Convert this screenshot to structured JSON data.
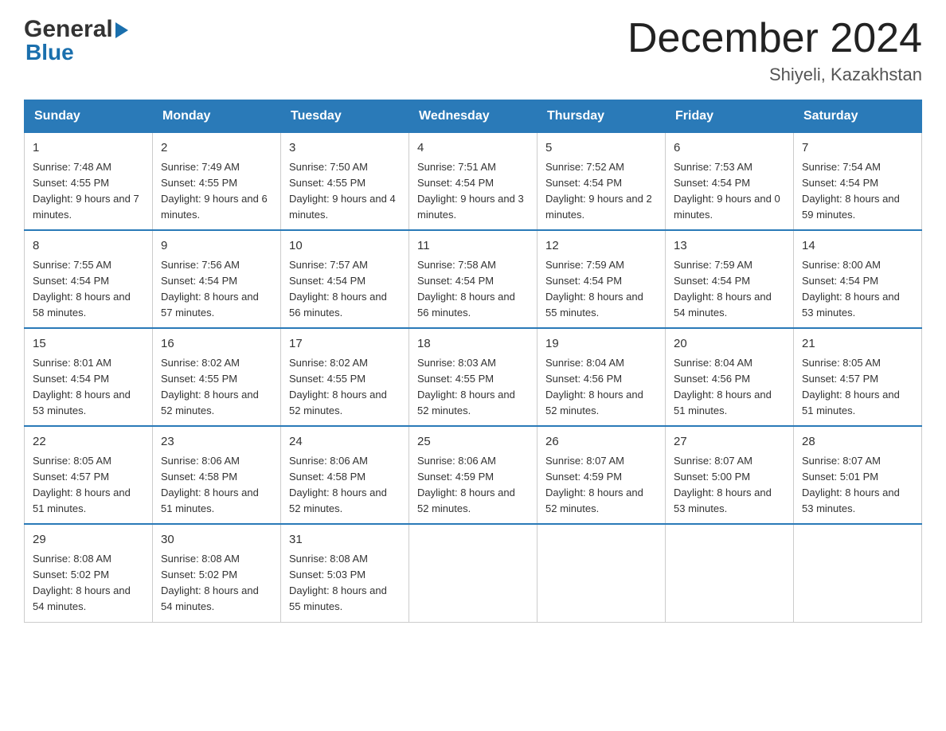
{
  "header": {
    "logo": {
      "general": "General",
      "blue": "Blue"
    },
    "title": "December 2024",
    "location": "Shiyeli, Kazakhstan"
  },
  "weekdays": [
    "Sunday",
    "Monday",
    "Tuesday",
    "Wednesday",
    "Thursday",
    "Friday",
    "Saturday"
  ],
  "weeks": [
    [
      {
        "day": "1",
        "sunrise": "7:48 AM",
        "sunset": "4:55 PM",
        "daylight": "9 hours and 7 minutes."
      },
      {
        "day": "2",
        "sunrise": "7:49 AM",
        "sunset": "4:55 PM",
        "daylight": "9 hours and 6 minutes."
      },
      {
        "day": "3",
        "sunrise": "7:50 AM",
        "sunset": "4:55 PM",
        "daylight": "9 hours and 4 minutes."
      },
      {
        "day": "4",
        "sunrise": "7:51 AM",
        "sunset": "4:54 PM",
        "daylight": "9 hours and 3 minutes."
      },
      {
        "day": "5",
        "sunrise": "7:52 AM",
        "sunset": "4:54 PM",
        "daylight": "9 hours and 2 minutes."
      },
      {
        "day": "6",
        "sunrise": "7:53 AM",
        "sunset": "4:54 PM",
        "daylight": "9 hours and 0 minutes."
      },
      {
        "day": "7",
        "sunrise": "7:54 AM",
        "sunset": "4:54 PM",
        "daylight": "8 hours and 59 minutes."
      }
    ],
    [
      {
        "day": "8",
        "sunrise": "7:55 AM",
        "sunset": "4:54 PM",
        "daylight": "8 hours and 58 minutes."
      },
      {
        "day": "9",
        "sunrise": "7:56 AM",
        "sunset": "4:54 PM",
        "daylight": "8 hours and 57 minutes."
      },
      {
        "day": "10",
        "sunrise": "7:57 AM",
        "sunset": "4:54 PM",
        "daylight": "8 hours and 56 minutes."
      },
      {
        "day": "11",
        "sunrise": "7:58 AM",
        "sunset": "4:54 PM",
        "daylight": "8 hours and 56 minutes."
      },
      {
        "day": "12",
        "sunrise": "7:59 AM",
        "sunset": "4:54 PM",
        "daylight": "8 hours and 55 minutes."
      },
      {
        "day": "13",
        "sunrise": "7:59 AM",
        "sunset": "4:54 PM",
        "daylight": "8 hours and 54 minutes."
      },
      {
        "day": "14",
        "sunrise": "8:00 AM",
        "sunset": "4:54 PM",
        "daylight": "8 hours and 53 minutes."
      }
    ],
    [
      {
        "day": "15",
        "sunrise": "8:01 AM",
        "sunset": "4:54 PM",
        "daylight": "8 hours and 53 minutes."
      },
      {
        "day": "16",
        "sunrise": "8:02 AM",
        "sunset": "4:55 PM",
        "daylight": "8 hours and 52 minutes."
      },
      {
        "day": "17",
        "sunrise": "8:02 AM",
        "sunset": "4:55 PM",
        "daylight": "8 hours and 52 minutes."
      },
      {
        "day": "18",
        "sunrise": "8:03 AM",
        "sunset": "4:55 PM",
        "daylight": "8 hours and 52 minutes."
      },
      {
        "day": "19",
        "sunrise": "8:04 AM",
        "sunset": "4:56 PM",
        "daylight": "8 hours and 52 minutes."
      },
      {
        "day": "20",
        "sunrise": "8:04 AM",
        "sunset": "4:56 PM",
        "daylight": "8 hours and 51 minutes."
      },
      {
        "day": "21",
        "sunrise": "8:05 AM",
        "sunset": "4:57 PM",
        "daylight": "8 hours and 51 minutes."
      }
    ],
    [
      {
        "day": "22",
        "sunrise": "8:05 AM",
        "sunset": "4:57 PM",
        "daylight": "8 hours and 51 minutes."
      },
      {
        "day": "23",
        "sunrise": "8:06 AM",
        "sunset": "4:58 PM",
        "daylight": "8 hours and 51 minutes."
      },
      {
        "day": "24",
        "sunrise": "8:06 AM",
        "sunset": "4:58 PM",
        "daylight": "8 hours and 52 minutes."
      },
      {
        "day": "25",
        "sunrise": "8:06 AM",
        "sunset": "4:59 PM",
        "daylight": "8 hours and 52 minutes."
      },
      {
        "day": "26",
        "sunrise": "8:07 AM",
        "sunset": "4:59 PM",
        "daylight": "8 hours and 52 minutes."
      },
      {
        "day": "27",
        "sunrise": "8:07 AM",
        "sunset": "5:00 PM",
        "daylight": "8 hours and 53 minutes."
      },
      {
        "day": "28",
        "sunrise": "8:07 AM",
        "sunset": "5:01 PM",
        "daylight": "8 hours and 53 minutes."
      }
    ],
    [
      {
        "day": "29",
        "sunrise": "8:08 AM",
        "sunset": "5:02 PM",
        "daylight": "8 hours and 54 minutes."
      },
      {
        "day": "30",
        "sunrise": "8:08 AM",
        "sunset": "5:02 PM",
        "daylight": "8 hours and 54 minutes."
      },
      {
        "day": "31",
        "sunrise": "8:08 AM",
        "sunset": "5:03 PM",
        "daylight": "8 hours and 55 minutes."
      },
      null,
      null,
      null,
      null
    ]
  ]
}
